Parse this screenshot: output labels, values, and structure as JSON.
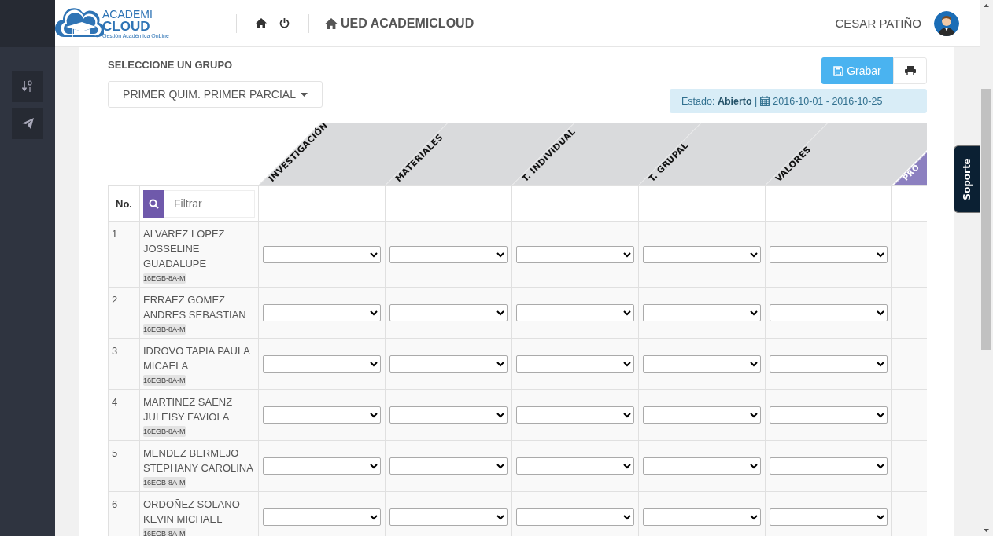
{
  "header": {
    "logo": {
      "line1": "ACADEMI",
      "line2": "CLOUD",
      "tagline": "Gestión Académica OnLine"
    },
    "school": "UED ACADEMICLOUD",
    "user": "CESAR PATIÑO"
  },
  "group_label": "SELECCIONE UN GRUPO",
  "group_dropdown": "PRIMER QUIM. PRIMER PARCIAL",
  "save_button": "Grabar",
  "status": {
    "text": "Estado: **Abierto** |",
    "dates": "2016-10-01 - 2016-10-25"
  },
  "table": {
    "no_header": "No.",
    "filter_placeholder": "Filtrar",
    "columns": [
      {
        "label": "INVESTIGACIÓN",
        "kind": "grade"
      },
      {
        "label": "MATERIALES",
        "kind": "grade"
      },
      {
        "label": "T. INDIVIDUAL",
        "kind": "grade"
      },
      {
        "label": "T. GRUPAL",
        "kind": "grade"
      },
      {
        "label": "VALORES",
        "kind": "grade"
      },
      {
        "label": "PRO",
        "kind": "average"
      }
    ],
    "rows": [
      {
        "no": "1",
        "name": "ALVAREZ LOPEZ JOSSELINE GUADALUPE",
        "group": "16EGB-8A-M"
      },
      {
        "no": "2",
        "name": "ERRAEZ GOMEZ ANDRES SEBASTIAN",
        "group": "16EGB-8A-M"
      },
      {
        "no": "3",
        "name": "IDROVO TAPIA PAULA MICAELA",
        "group": "16EGB-8A-M"
      },
      {
        "no": "4",
        "name": "MARTINEZ SAENZ JULEISY FAVIOLA",
        "group": "16EGB-8A-M"
      },
      {
        "no": "5",
        "name": "MENDEZ BERMEJO STEPHANY CAROLINA",
        "group": "16EGB-8A-M"
      },
      {
        "no": "6",
        "name": "ORDOÑEZ SOLANO KEVIN MICHAEL",
        "group": "16EGB-8A-M"
      }
    ]
  },
  "support_tab": "Soporte"
}
